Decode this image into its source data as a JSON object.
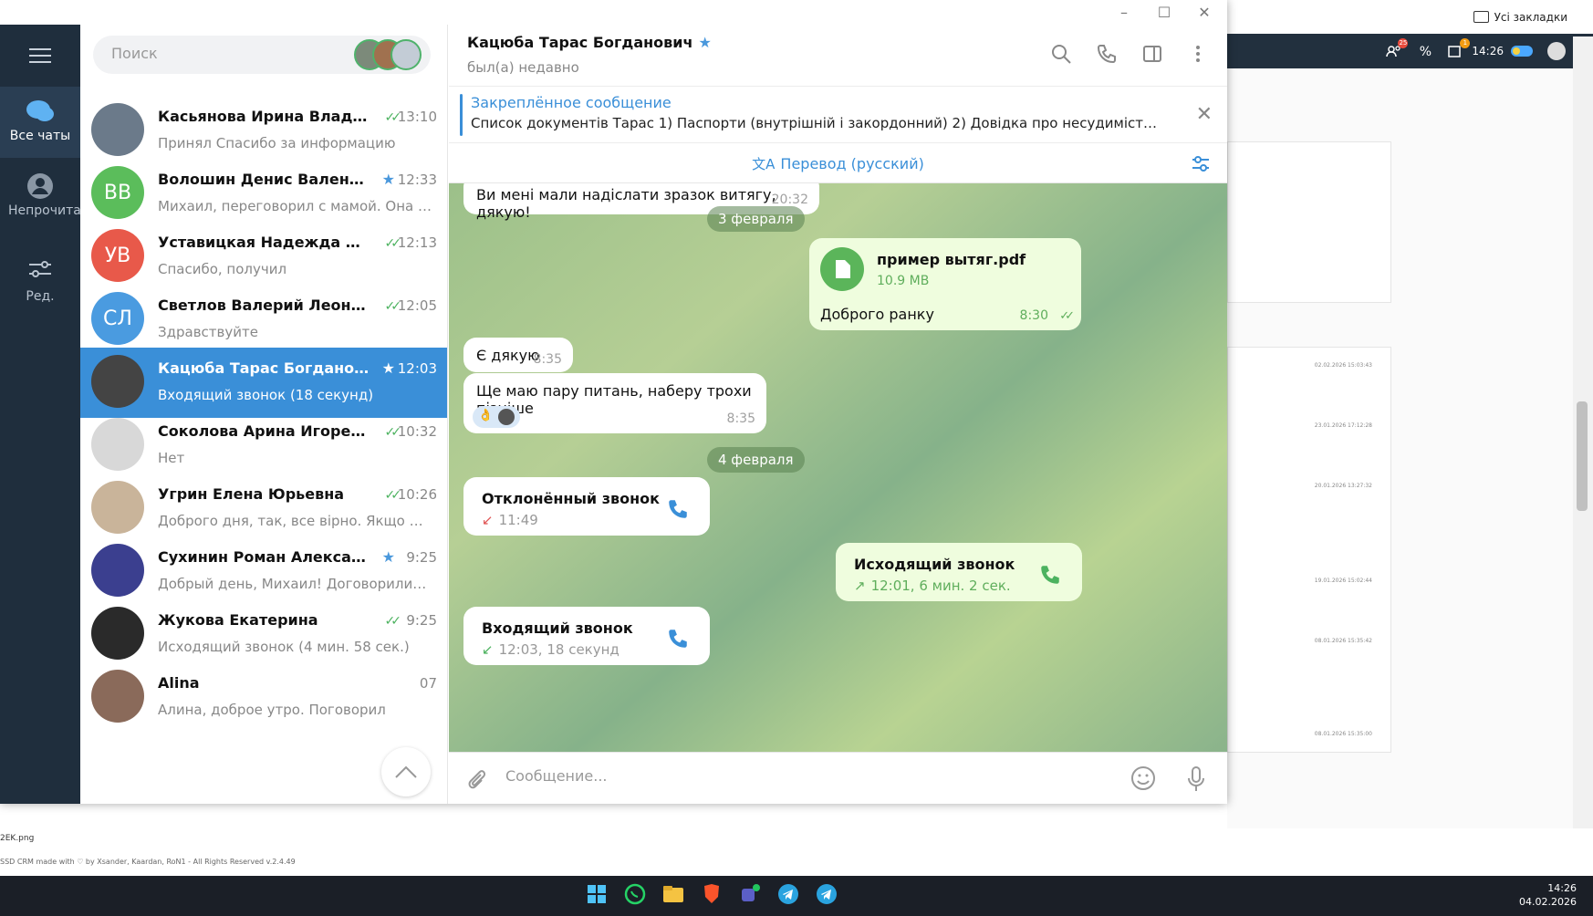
{
  "background": {
    "bookmarks_label": "Усі закладки",
    "time_small": "14:26",
    "badge_counts": [
      "25",
      "1"
    ],
    "dates": [
      "02.02.2026 15:03:43",
      "23.01.2026 17:12:28",
      "20.01.2026 13:27:32",
      "19.01.2026 15:02:44",
      "08.01.2026 15:35:42",
      "08.01.2026 15:35:00"
    ],
    "filename": "2EK.png",
    "footer": "SSD CRM made with ♡ by Xsander, Kaardan, RoN1 - All Rights Reserved v.2.4.49"
  },
  "taskbar": {
    "time": "14:26",
    "date": "04.02.2026",
    "apps": [
      "windows-start",
      "whatsapp",
      "file-explorer",
      "brave",
      "teams",
      "telegram",
      "telegram-2"
    ]
  },
  "rail": {
    "items": [
      {
        "label": "Все чаты",
        "icon": "chats-icon"
      },
      {
        "label": "Непрочитано",
        "icon": "person-icon"
      },
      {
        "label": "Ред.",
        "icon": "edit-filters-icon"
      }
    ]
  },
  "search": {
    "placeholder": "Поиск"
  },
  "chats": [
    {
      "name": "Касьянова Ирина Влади...",
      "time": "13:10",
      "preview": "Принял Спасибо за информацию",
      "initials": "",
      "color": "#6b7a8a",
      "check": true,
      "star": false
    },
    {
      "name": "Волошин Денис Валентино...",
      "time": "12:33",
      "preview": "Михаил, переговорил с мамой. Она н...",
      "initials": "ВВ",
      "color": "#5bbd5b",
      "check": false,
      "star": true
    },
    {
      "name": "Уставицкая Надежда Влад...",
      "time": "12:13",
      "preview": "Спасибо, получил",
      "initials": "УВ",
      "color": "#e8594a",
      "check": true,
      "star": false
    },
    {
      "name": "Светлов Валерий Леонидо...",
      "time": "12:05",
      "preview": "Здравствуйте",
      "initials": "СЛ",
      "color": "#4a9be0",
      "check": true,
      "star": false
    },
    {
      "name": "Кацюба Тарас Богданович",
      "time": "12:03",
      "preview": "Входящий звонок (18 секунд)",
      "initials": "",
      "color": "#444444",
      "check": false,
      "star": true
    },
    {
      "name": "Соколова Арина Игоревна",
      "time": "10:32",
      "preview": "Нет",
      "initials": "",
      "color": "#d8d8d8",
      "check": true,
      "star": false
    },
    {
      "name": "Угрин Елена Юрьевна",
      "time": "10:26",
      "preview": "Доброго дня, так, все вірно. Якщо не ...",
      "initials": "",
      "color": "#c9b49a",
      "check": true,
      "star": false
    },
    {
      "name": "Сухинин Роман Александро...",
      "time": "9:25",
      "preview": "Добрый день, Михаил!  Договорилис...",
      "initials": "",
      "color": "#3b3f8f",
      "check": false,
      "star": true
    },
    {
      "name": "Жукова Екатерина",
      "time": "9:25",
      "preview": "Исходящий звонок (4 мин. 58 сек.)",
      "initials": "",
      "color": "#2a2a2a",
      "check": true,
      "star": false
    },
    {
      "name": "Alina",
      "time": "07",
      "preview": "Алина, доброе утро. Поговорил",
      "initials": "",
      "color": "#8a6a5a",
      "check": false,
      "star": false
    }
  ],
  "header": {
    "name": "Кацюба Тарас Богданович",
    "status": "был(а) недавно"
  },
  "pinned": {
    "title": "Закреплённое сообщение",
    "text": "Список документів Тарас  1) Паспорти (внутрішній і закордонний) 2) Довідка про несудимість +..."
  },
  "translate": {
    "label": "Перевод (русский)"
  },
  "messages": {
    "m1": {
      "text": "Ви мені мали надіслати зразок витягу, дякую!",
      "time": "20:32"
    },
    "date1": "3 февраля",
    "file": {
      "name": "пример вытяг.pdf",
      "size": "10.9 MB",
      "caption": "Доброго ранку",
      "time": "8:30"
    },
    "m2": {
      "text": "Є дякую",
      "time": "8:35"
    },
    "m3": {
      "text": "Ще маю пару питань, наберу трохи пізніше",
      "time": "8:35"
    },
    "date2": "4 февраля",
    "call1": {
      "title": "Отклонённый звонок",
      "meta": "11:49"
    },
    "call2": {
      "title": "Исходящий звонок",
      "meta": "12:01, 6 мин. 2 сек."
    },
    "call3": {
      "title": "Входящий звонок",
      "meta": "12:03, 18 секунд"
    }
  },
  "composer": {
    "placeholder": "Сообщение..."
  },
  "colors": {
    "accent": "#3a8fd8",
    "green": "#4cb25f",
    "rail": "#1f2e3d",
    "declined": "#e05555"
  }
}
